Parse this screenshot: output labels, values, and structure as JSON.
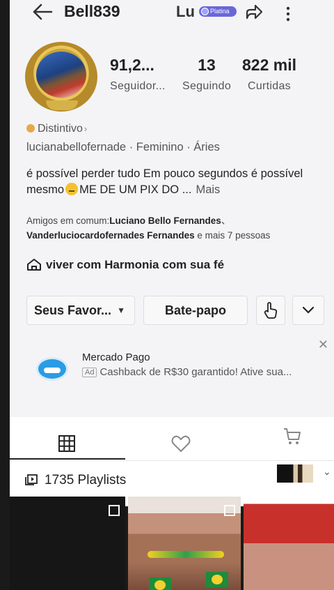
{
  "header": {
    "username": "Bell839",
    "display_name_short": "Lu",
    "badge_label": "Platina"
  },
  "stats": [
    {
      "value": "91,2...",
      "label": "Seguidor..."
    },
    {
      "value": "13",
      "label": "Seguindo"
    },
    {
      "value": "822 mil",
      "label": "Curtidas"
    }
  ],
  "profile": {
    "distintivo_label": "Distintivo",
    "info_line": "lucianabellofernade · Feminino · Áries",
    "bio_part1": "é possível perder tudo Em pouco segundos é possível mesmo",
    "bio_part2": "ME DE UM PIX DO ...",
    "bio_more": "Mais",
    "mutual_prefix": "Amigos em comum:",
    "mutual_names_1": "Luciano Bello Fernandes",
    "mutual_sep": "、",
    "mutual_names_2": "Vanderluciocardofernades Fernandes",
    "mutual_suffix": " e mais 7 pessoas",
    "community": "viver com Harmonia com sua fé"
  },
  "actions": {
    "favorites_label": "Seus Favor...",
    "chat_label": "Bate-papo"
  },
  "ad": {
    "title": "Mercado Pago",
    "tag": "Ad",
    "text": "Cashback de R$30 garantido! Ative sua..."
  },
  "content": {
    "playlists_label": "1735 Playlists"
  },
  "icons": {
    "back": "arrow-left-icon",
    "share": "share-icon",
    "more": "more-vertical-icon",
    "grid": "grid-icon",
    "heart": "heart-icon",
    "cart": "cart-icon"
  }
}
